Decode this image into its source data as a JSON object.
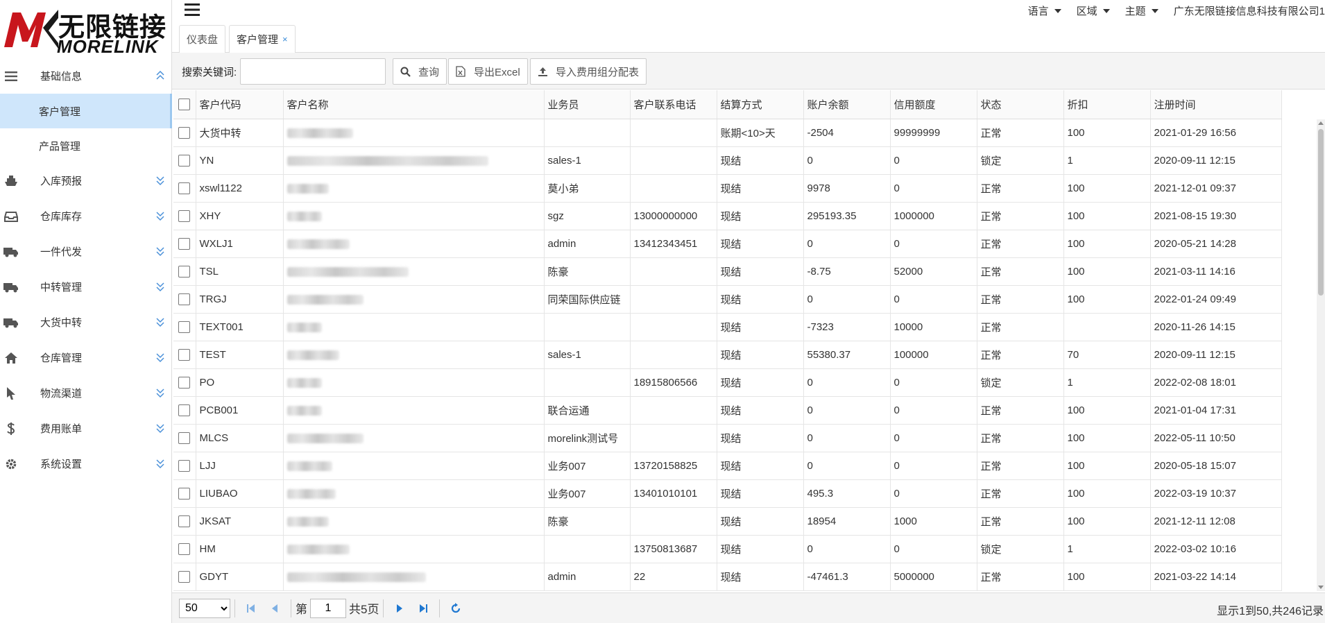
{
  "brand": {
    "cn": "无限链接",
    "en": "MORELINK"
  },
  "sidebar": {
    "items": [
      {
        "label": "基础信息",
        "icon": "list-icon",
        "expanded": true,
        "children": [
          {
            "label": "客户管理",
            "active": true
          },
          {
            "label": "产品管理",
            "active": false
          }
        ]
      },
      {
        "label": "入库预报",
        "icon": "ship-icon"
      },
      {
        "label": "仓库库存",
        "icon": "inbox-icon"
      },
      {
        "label": "一件代发",
        "icon": "truck-icon"
      },
      {
        "label": "中转管理",
        "icon": "truck-icon"
      },
      {
        "label": "大货中转",
        "icon": "truck-icon"
      },
      {
        "label": "仓库管理",
        "icon": "home-icon"
      },
      {
        "label": "物流渠道",
        "icon": "cursor-icon"
      },
      {
        "label": "费用账单",
        "icon": "dollar-icon"
      },
      {
        "label": "系统设置",
        "icon": "gear-icon"
      }
    ]
  },
  "topbar": {
    "menus": [
      "语言",
      "区域",
      "主题",
      "广东无限链接信息科技有限公司1"
    ]
  },
  "tabs": [
    {
      "label": "仪表盘",
      "closable": false,
      "active": false
    },
    {
      "label": "客户管理",
      "closable": true,
      "active": true,
      "close_glyph": "×"
    }
  ],
  "toolbar": {
    "search_label": "搜索关键词:",
    "search_value": "",
    "query_label": "查询",
    "export_label": "导出Excel",
    "import_label": "导入费用组分配表"
  },
  "table": {
    "columns": [
      "客户代码",
      "客户名称",
      "业务员",
      "客户联系电话",
      "结算方式",
      "账户余额",
      "信用额度",
      "状态",
      "折扣",
      "注册时间"
    ],
    "rows": [
      [
        "大货中转",
        "",
        "",
        "",
        "账期<10>天",
        "-2504",
        "99999999",
        "正常",
        "100",
        "2021-01-29 16:56"
      ],
      [
        "YN",
        "",
        "sales-1",
        "",
        "现结",
        "0",
        "0",
        "锁定",
        "1",
        "2020-09-11 12:15"
      ],
      [
        "xswl1122",
        "",
        "莫小弟",
        "",
        "现结",
        "9978",
        "0",
        "正常",
        "100",
        "2021-12-01 09:37"
      ],
      [
        "XHY",
        "",
        "sgz",
        "13000000000",
        "现结",
        "295193.35",
        "1000000",
        "正常",
        "100",
        "2021-08-15 19:30"
      ],
      [
        "WXLJ1",
        "",
        "admin",
        "13412343451",
        "现结",
        "0",
        "0",
        "正常",
        "100",
        "2020-05-21 14:28"
      ],
      [
        "TSL",
        "",
        "陈豪",
        "",
        "现结",
        "-8.75",
        "52000",
        "正常",
        "100",
        "2021-03-11 14:16"
      ],
      [
        "TRGJ",
        "",
        "同荣国际供应链",
        "",
        "现结",
        "0",
        "0",
        "正常",
        "100",
        "2022-01-24 09:49"
      ],
      [
        "TEXT001",
        "",
        "",
        "",
        "现结",
        "-7323",
        "10000",
        "正常",
        "",
        "2020-11-26 14:15"
      ],
      [
        "TEST",
        "",
        "sales-1",
        "",
        "现结",
        "55380.37",
        "100000",
        "正常",
        "70",
        "2020-09-11 12:15"
      ],
      [
        "PO",
        "",
        "",
        "18915806566",
        "现结",
        "0",
        "0",
        "锁定",
        "1",
        "2022-02-08 18:01"
      ],
      [
        "PCB001",
        "",
        "联合运通",
        "",
        "现结",
        "0",
        "0",
        "正常",
        "100",
        "2021-01-04 17:31"
      ],
      [
        "MLCS",
        "",
        "morelink测试号",
        "",
        "现结",
        "0",
        "0",
        "正常",
        "100",
        "2022-05-11 10:50"
      ],
      [
        "LJJ",
        "",
        "业务007",
        "13720158825",
        "现结",
        "0",
        "0",
        "正常",
        "100",
        "2020-05-18 15:07"
      ],
      [
        "LIUBAO",
        "",
        "业务007",
        "13401010101",
        "现结",
        "495.3",
        "0",
        "正常",
        "100",
        "2022-03-19 10:37"
      ],
      [
        "JKSAT",
        "",
        "陈豪",
        "",
        "现结",
        "18954",
        "1000",
        "正常",
        "100",
        "2021-12-11 12:08"
      ],
      [
        "HM",
        "",
        "",
        "13750813687",
        "现结",
        "0",
        "0",
        "锁定",
        "1",
        "2022-03-02 10:16"
      ],
      [
        "GDYT",
        "",
        "admin",
        "22",
        "现结",
        "-47461.3",
        "5000000",
        "正常",
        "100",
        "2021-03-22 14:14"
      ]
    ]
  },
  "pager": {
    "page_size": "50",
    "page_prefix": "第",
    "page_value": "1",
    "page_suffix": "共5页",
    "info": "显示1到50,共246记录"
  },
  "colors": {
    "active_menu_bg": "#cfe6fb",
    "accent": "#3c8dd8",
    "brand_red": "#c8161d"
  }
}
